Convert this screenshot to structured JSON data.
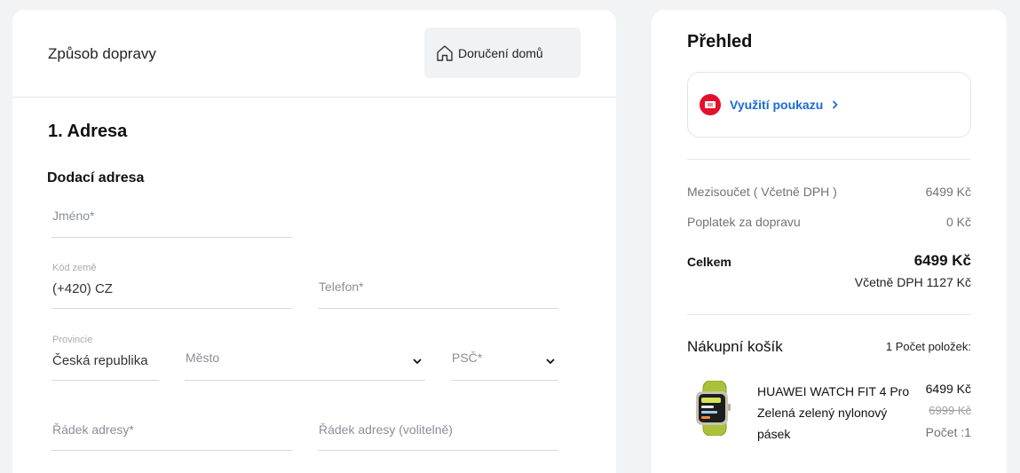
{
  "shipping": {
    "title": "Způsob dopravy",
    "option_label": "Doručení domů",
    "option_icon": "home-icon"
  },
  "address": {
    "section_title": "1. Adresa",
    "subtitle": "Dodací adresa",
    "name_placeholder": "Jméno*",
    "country_code_label": "Kód země",
    "country_code_value": "(+420) CZ",
    "phone_placeholder": "Telefon*",
    "province_label": "Provincie",
    "province_value": "Česká republika",
    "city_placeholder": "Město",
    "zip_placeholder": "PSČ*",
    "address_line_placeholder": "Řádek adresy*",
    "address_line_optional_placeholder": "Řádek adresy (volitelně)"
  },
  "overview": {
    "title": "Přehled",
    "voucher_label": "Využití poukazu",
    "voucher_icon": "voucher-icon",
    "subtotal_label": "Mezisoučet ( Včetně DPH )",
    "subtotal_value": "6499 Kč",
    "shipping_fee_label": "Poplatek za dopravu",
    "shipping_fee_value": "0 Kč",
    "total_label": "Celkem",
    "total_value": "6499 Kč",
    "vat_value": "Včetně DPH 1127 Kč"
  },
  "cart": {
    "title": "Nákupní košík",
    "count_label": "1 Počet položek:",
    "items": [
      {
        "name": "HUAWEI WATCH FIT 4 Pro Zelená zelený nylonový pásek",
        "price": "6499 Kč",
        "old_price": "6999 Kč",
        "quantity": "Počet :1"
      }
    ]
  },
  "colors": {
    "accent_blue": "#1a6bd6",
    "voucher_red": "#e30f2b",
    "background": "#f1f3f5"
  }
}
